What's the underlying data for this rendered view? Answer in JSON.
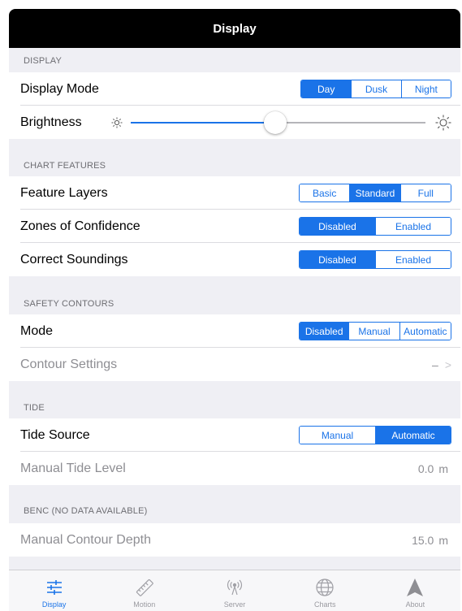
{
  "navbar": {
    "title": "Display"
  },
  "display": {
    "header": "DISPLAY",
    "mode": {
      "label": "Display Mode",
      "options": [
        "Day",
        "Dusk",
        "Night"
      ],
      "selected": "Day"
    },
    "brightness": {
      "label": "Brightness",
      "level": 0.49
    }
  },
  "chart_features": {
    "header": "CHART FEATURES",
    "feature_layers": {
      "label": "Feature Layers",
      "options": [
        "Basic",
        "Standard",
        "Full"
      ],
      "selected": "Standard"
    },
    "zones_of_confidence": {
      "label": "Zones of Confidence",
      "options": [
        "Disabled",
        "Enabled"
      ],
      "selected": "Disabled"
    },
    "correct_soundings": {
      "label": "Correct Soundings",
      "options": [
        "Disabled",
        "Enabled"
      ],
      "selected": "Disabled"
    }
  },
  "safety_contours": {
    "header": "SAFETY CONTOURS",
    "mode": {
      "label": "Mode",
      "options": [
        "Disabled",
        "Manual",
        "Automatic"
      ],
      "selected": "Disabled"
    },
    "contour_settings": {
      "label": "Contour Settings",
      "value": "–",
      "chevron": ">"
    }
  },
  "tide": {
    "header": "TIDE",
    "tide_source": {
      "label": "Tide Source",
      "options": [
        "Manual",
        "Automatic"
      ],
      "selected": "Automatic"
    },
    "manual_tide_level": {
      "label": "Manual Tide Level",
      "value": "0.0",
      "unit": "m"
    }
  },
  "benc": {
    "header": "BENC (NO DATA AVAILABLE)",
    "manual_contour_depth": {
      "label": "Manual Contour Depth",
      "value": "15.0",
      "unit": "m"
    }
  },
  "tabbar": {
    "tabs": [
      {
        "label": "Display",
        "icon": "sliders-icon",
        "active": true
      },
      {
        "label": "Motion",
        "icon": "ruler-icon",
        "active": false
      },
      {
        "label": "Server",
        "icon": "antenna-icon",
        "active": false
      },
      {
        "label": "Charts",
        "icon": "globe-icon",
        "active": false
      },
      {
        "label": "About",
        "icon": "arrow-up-icon",
        "active": false
      }
    ]
  },
  "colors": {
    "accent": "#1a73e8",
    "navbar": "#000000",
    "background": "#efeff4"
  }
}
